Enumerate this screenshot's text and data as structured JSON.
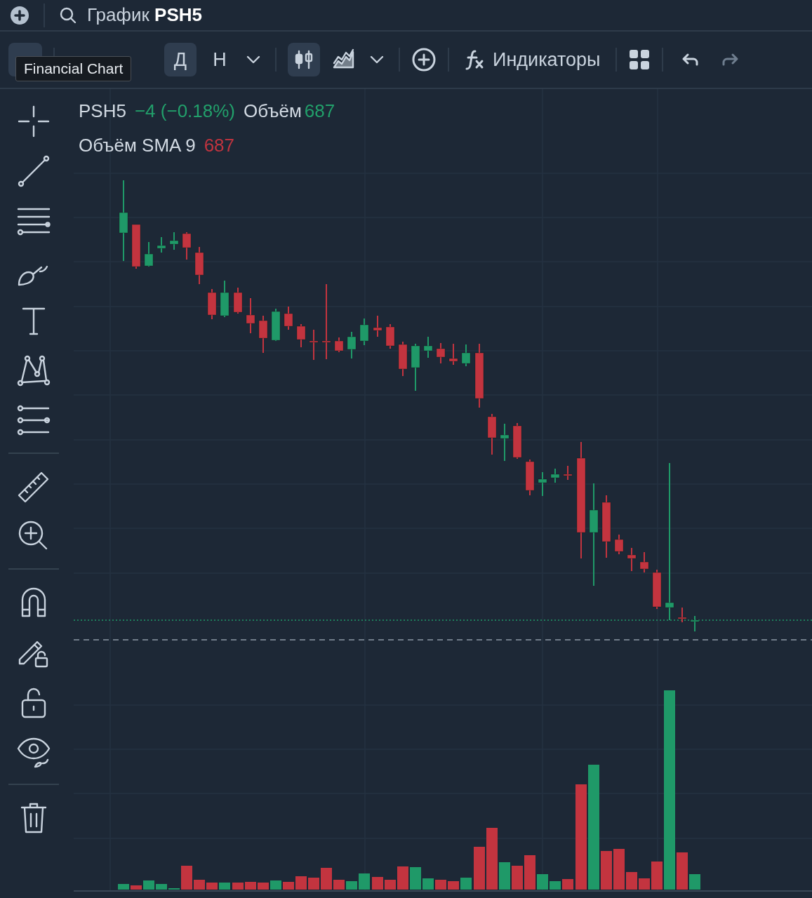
{
  "top_bar": {
    "title": "График **PSH5**"
  },
  "toolbar": {
    "intervals": [
      {
        "label": "Д",
        "selected": true
      },
      {
        "label": "Н",
        "selected": false
      }
    ],
    "chart_types": [
      {
        "selected": true
      },
      {
        "selected": false
      }
    ],
    "indicators_label": "Индикаторы",
    "undo": {
      "disabled": false
    },
    "redo": {
      "disabled": true
    },
    "tooltip": "Financial Chart"
  },
  "legend": [
    {
      "items": [
        {
          "text": "PSH5",
          "color": "#d2dae3"
        },
        {
          "text": "−4 (−0.18%)",
          "color": "#22a06b"
        },
        {
          "text": "Объём",
          "color": "#d2dae3"
        },
        {
          "text": "687",
          "color": "#22a06b"
        }
      ]
    },
    {
      "items": [
        {
          "text": "Объём SMA 9",
          "color": "#d2dae3"
        },
        {
          "text": "687",
          "color": "#c0343f"
        }
      ]
    }
  ]
}
